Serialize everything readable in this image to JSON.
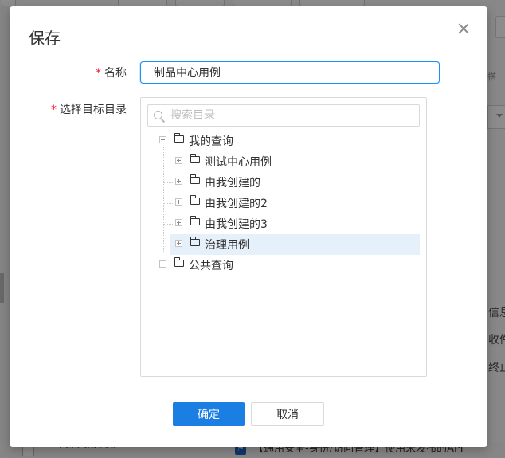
{
  "modal": {
    "title": "保存",
    "name_label": "名称",
    "name_value": "制品中心用例",
    "dir_label": "选择目标目录",
    "search_placeholder": "搜索目录",
    "tree": {
      "root1": "我的查询",
      "children": [
        "测试中心用例",
        "由我创建的",
        "由我创建的2",
        "由我创建的3",
        "治理用例"
      ],
      "selected_child": "治理用例",
      "root2": "公共查询"
    },
    "confirm_label": "确定",
    "cancel_label": "取消"
  },
  "background": {
    "side_texts": [
      "信息",
      "收件",
      "终止"
    ],
    "bottom_row_code": "PLM-00110",
    "bottom_row_text": "【通用安全-身份/访问管理】使用未发布的API"
  },
  "colors": {
    "primary": "#1a7ee3",
    "required": "#f5222d",
    "selected_bg": "#e6f0fb"
  }
}
